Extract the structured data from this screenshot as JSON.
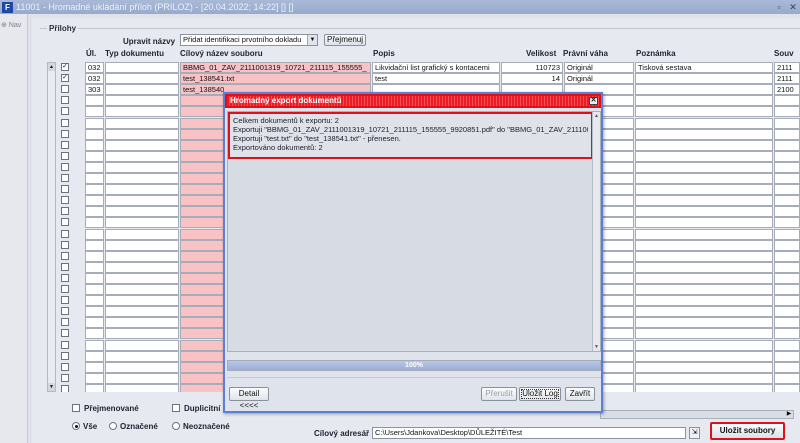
{
  "window": {
    "title": "11001 - Hromadné ukládání příloh (PRILOZ) - [20.04.2022; 14:22] [] []",
    "app_icon": "F",
    "btn_restore": "▫",
    "btn_close": "✕"
  },
  "nav": {
    "label": "Nav"
  },
  "group": {
    "title": "Přílohy"
  },
  "toolbar": {
    "rename_label": "Upravit názvy",
    "rename_select": "Přidat identifikaci prvotního dokladu",
    "rename_button": "Přejmenuj"
  },
  "columns": {
    "ul": "Úl.",
    "typ": "Typ dokumentu",
    "cilovy": "Cílový název souboru",
    "popis": "Popis",
    "velikost": "Velikost",
    "pravni": "Právní váha",
    "poznamka": "Poznámka",
    "souv": "Souv"
  },
  "rows": [
    {
      "checked": "✓",
      "ul": "032",
      "cilovy": "BBMG_01_ZAV_2111001319_10721_211115_155555_",
      "popis": "Likvidační list grafický s kontacemi",
      "velikost": "110723",
      "pravni": "Originál",
      "poznamka": "Tisková sestava",
      "souv": "2111"
    },
    {
      "checked": "✓",
      "ul": "032",
      "cilovy": "test_138541.txt",
      "popis": "test",
      "velikost": "14",
      "pravni": "Originál",
      "poznamka": "",
      "souv": "2111"
    },
    {
      "checked": "",
      "ul": "303",
      "cilovy": "test_138540",
      "popis": "",
      "velikost": "",
      "pravni": "",
      "poznamka": "",
      "souv": "2100"
    }
  ],
  "bottom": {
    "prejmenovane": "Přejmenované",
    "duplicitni": "Duplicitní",
    "radio_vse": "Vše",
    "radio_oznacene": "Označené",
    "radio_neoznacene": "Neoznačené",
    "cilovy_adresar_label": "Cílový adresář",
    "cilovy_adresar_value": "C:\\Users\\Jdankova\\Desktop\\DŮLEŽITÉ\\Test",
    "save_button": "Uložit soubory"
  },
  "modal": {
    "title": "Hromadný export dokumentů",
    "close": "✕",
    "log": [
      "Celkem dokumentů k exportu: 2",
      "Exportuji \"BBMG_01_ZAV_2111001319_10721_211115_155555_9920851.pdf\" do \"BBMG_01_ZAV_2111001",
      "Exportuji \"test.txt\" do \"test_138541.txt\" - přenesen.",
      "Exportováno dokumentů: 2"
    ],
    "progress_value": 100,
    "progress_label": "100%",
    "detail_button": "Detail <<<<",
    "prerusit_button": "Přerušit",
    "ulozit_log_button": "Uložit Log",
    "zavrit_button": "Zavřít"
  }
}
